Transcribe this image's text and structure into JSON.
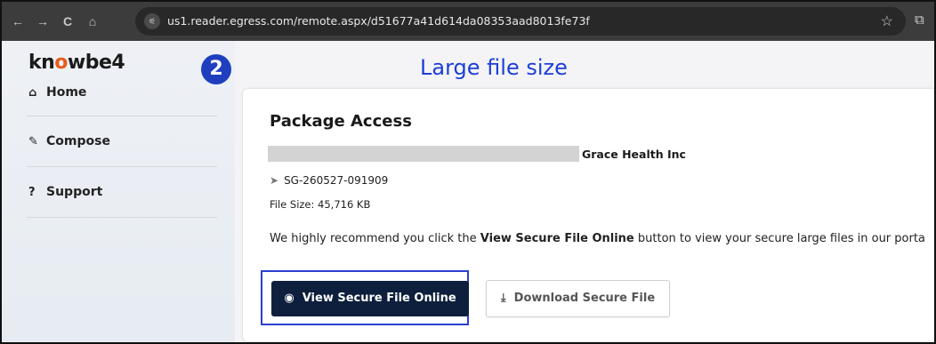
{
  "browser": {
    "url": "us1.reader.egress.com/remote.aspx/d51677a41d614da08353aad8013fe73f",
    "back_icon": "←",
    "forward_icon": "→",
    "reload_icon": "C",
    "home_icon": "⌂",
    "tune_icon": "⚟",
    "star_icon": "☆",
    "extension_icon": "⧉"
  },
  "sidebar": {
    "logo_pre": "kn",
    "logo_o": "o",
    "logo_post": "wbe4",
    "items": [
      {
        "icon": "⌂",
        "label": "Home"
      },
      {
        "icon": "✎",
        "label": "Compose"
      },
      {
        "icon": "?",
        "label": "Support"
      }
    ]
  },
  "annotation": {
    "step_number": "2",
    "caption": "Large file size"
  },
  "package": {
    "title": "Package Access",
    "organization": "Grace Health Inc",
    "reference_icon": "➤",
    "reference": "SG-260527-091909",
    "file_size": "File Size: 45,716 KB",
    "recommend_pre": "We highly recommend you click the ",
    "recommend_bold": "View Secure File Online",
    "recommend_post": " button to view your secure large files in our porta",
    "view_icon": "◉",
    "view_button": "View Secure File Online",
    "download_icon": "⤓",
    "download_button": "Download Secure File"
  },
  "colors": {
    "primary_button": "#0d1f3c",
    "annotation_blue": "#1c3fd6",
    "logo_accent": "#e85a1a"
  }
}
